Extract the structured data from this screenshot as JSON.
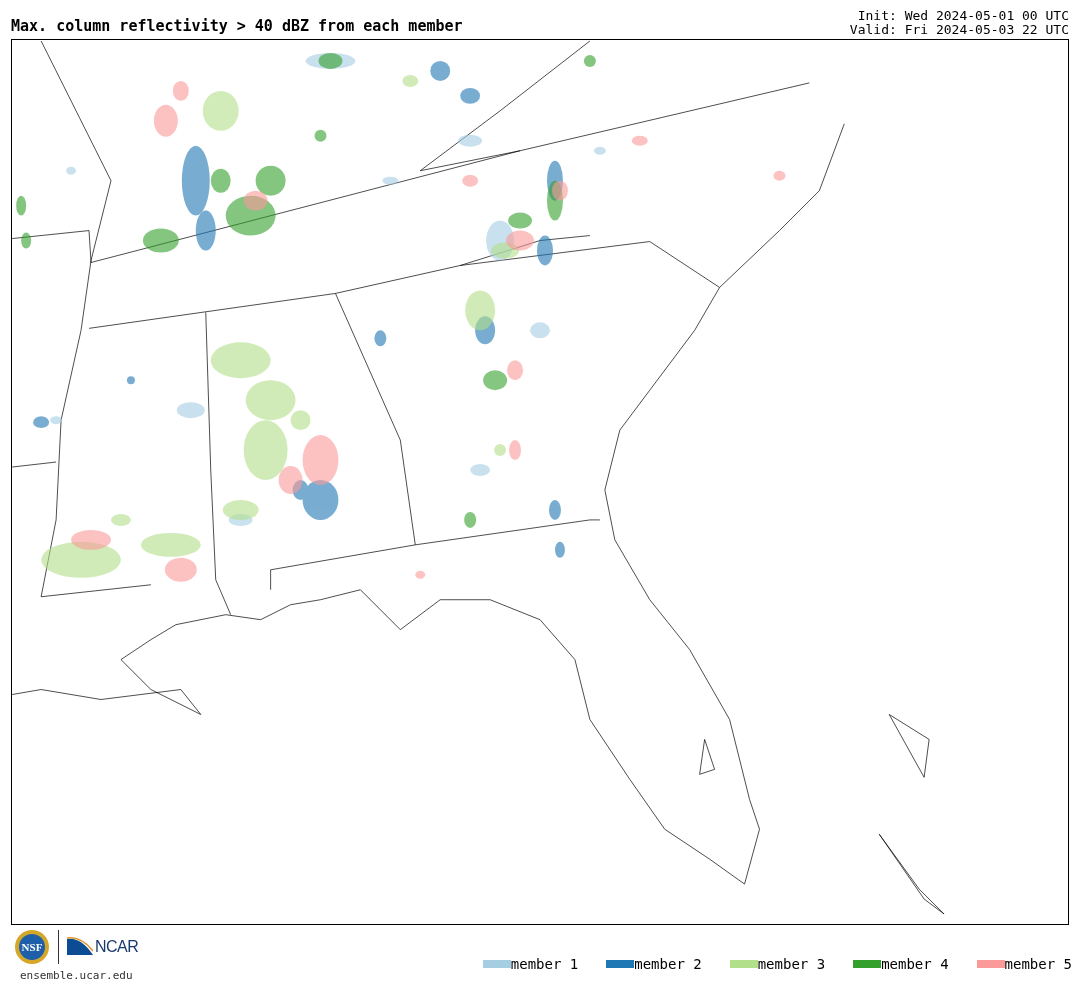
{
  "title": "Max. column reflectivity > 40 dBZ from each member",
  "init": "Init: Wed 2024-05-01 00 UTC",
  "valid": "Valid: Fri 2024-05-03 22 UTC",
  "footer": {
    "nsf_logo_text": "NSF",
    "ncar_logo_text": "NCAR",
    "site": "ensemble.ucar.edu"
  },
  "legend": [
    {
      "label": "member 1",
      "color": "#a6cee3"
    },
    {
      "label": "member 2",
      "color": "#1f78b4"
    },
    {
      "label": "member 3",
      "color": "#b2df8a"
    },
    {
      "label": "member 4",
      "color": "#33a02c"
    },
    {
      "label": "member 5",
      "color": "#fb9a99"
    }
  ]
}
